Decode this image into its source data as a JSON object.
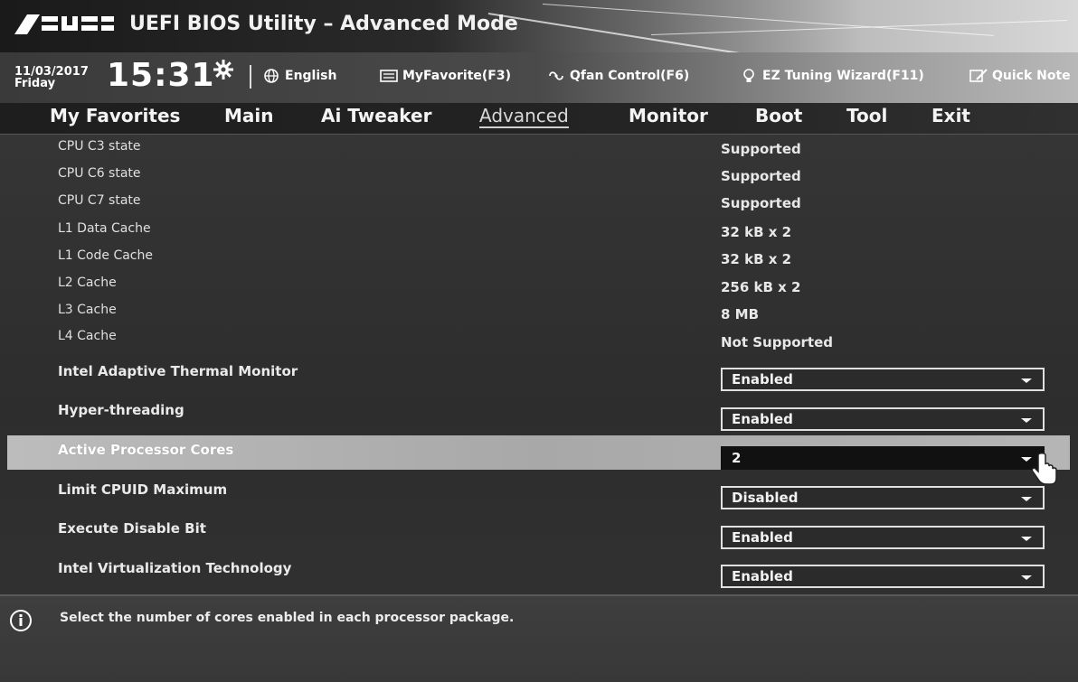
{
  "header": {
    "brand": "ASUS",
    "title": "UEFI BIOS Utility – Advanced Mode"
  },
  "infobar": {
    "date": "11/03/2017",
    "day": "Friday",
    "time": "15:31",
    "language": "English",
    "myfavorite": "MyFavorite(F3)",
    "qfan": "Qfan Control(F6)",
    "eztuning": "EZ Tuning Wizard(F11)",
    "quicknote": "Quick Note"
  },
  "menu": {
    "tabs": [
      "My Favorites",
      "Main",
      "Ai Tweaker",
      "Advanced",
      "Monitor",
      "Boot",
      "Tool",
      "Exit"
    ],
    "active": "Advanced"
  },
  "info_rows": [
    {
      "label": "CPU C3 state",
      "value": "Supported"
    },
    {
      "label": "CPU C6 state",
      "value": "Supported"
    },
    {
      "label": "CPU C7 state",
      "value": "Supported"
    },
    {
      "label": "L1 Data Cache",
      "value": "32 kB x 2"
    },
    {
      "label": "L1 Code Cache",
      "value": "32 kB x 2"
    },
    {
      "label": "L2 Cache",
      "value": "256 kB x 2"
    },
    {
      "label": "L3 Cache",
      "value": "8 MB"
    },
    {
      "label": "L4 Cache",
      "value": "Not Supported"
    }
  ],
  "settings": [
    {
      "label": "Intel Adaptive Thermal Monitor",
      "value": "Enabled"
    },
    {
      "label": "Hyper-threading",
      "value": "Enabled"
    },
    {
      "label": "Active Processor Cores",
      "value": "2"
    },
    {
      "label": "Limit CPUID Maximum",
      "value": "Disabled"
    },
    {
      "label": "Execute Disable Bit",
      "value": "Enabled"
    },
    {
      "label": "Intel Virtualization Technology",
      "value": "Enabled"
    }
  ],
  "help": {
    "text": "Select the number of cores enabled in each processor package."
  },
  "colors": {
    "highlight": "#b0b0b0",
    "text": "#e8e8e8",
    "background": "#333333"
  }
}
